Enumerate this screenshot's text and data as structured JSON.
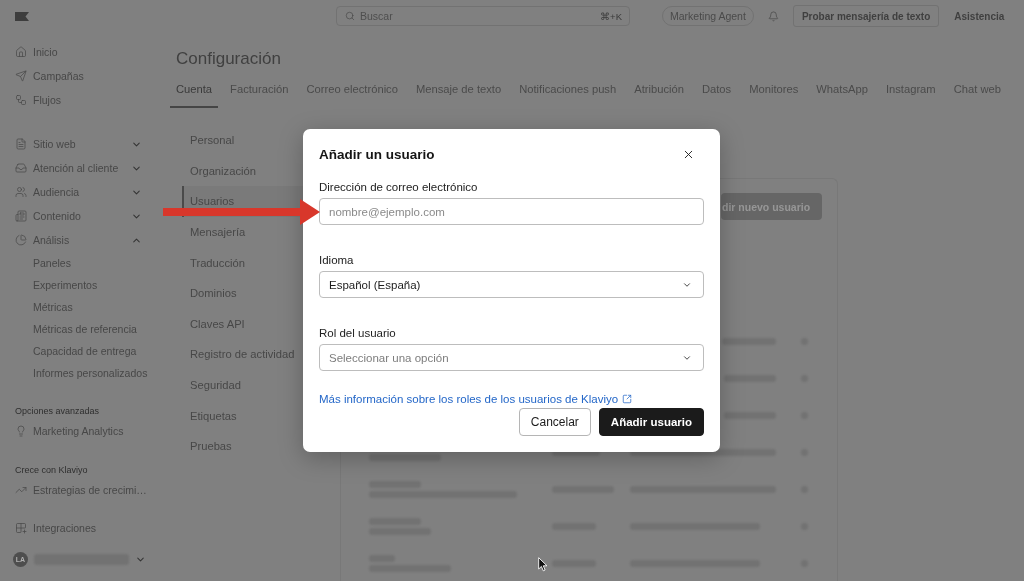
{
  "top_bar": {
    "search": {
      "placeholder": "Buscar",
      "shortcut": "⌘+K"
    },
    "agent_button": "Marketing Agent",
    "sms_button": "Probar mensajería de texto",
    "help_link": "Asistencia"
  },
  "sidebar": {
    "primary": [
      "Inicio",
      "Campañas",
      "Flujos"
    ],
    "groups": [
      {
        "label": "Sitio web",
        "expanded": false
      },
      {
        "label": "Atención al cliente",
        "expanded": false
      },
      {
        "label": "Audiencia",
        "expanded": false
      },
      {
        "label": "Contenido",
        "expanded": false
      },
      {
        "label": "Análisis",
        "expanded": true,
        "children": [
          "Paneles",
          "Experimentos",
          "Métricas",
          "Métricas de referencia",
          "Capacidad de entrega",
          "Informes personalizados"
        ]
      }
    ],
    "sections": [
      {
        "heading": "Opciones avanzadas",
        "items": [
          "Marketing Analytics"
        ]
      },
      {
        "heading": "Crece con Klaviyo",
        "items": [
          "Estrategias de crecimi…"
        ]
      }
    ],
    "integrations": "Integraciones",
    "account": {
      "initials": "LA"
    }
  },
  "main": {
    "title": "Configuración",
    "tabs": [
      {
        "label": "Cuenta",
        "selected": true
      },
      {
        "label": "Facturación",
        "selected": false
      },
      {
        "label": "Correo electrónico",
        "selected": false
      },
      {
        "label": "Mensaje de texto",
        "selected": false
      },
      {
        "label": "Notificaciones push",
        "selected": false
      },
      {
        "label": "Atribución",
        "selected": false
      },
      {
        "label": "Datos",
        "selected": false
      },
      {
        "label": "Monitores",
        "selected": false
      },
      {
        "label": "WhatsApp",
        "selected": false
      },
      {
        "label": "Instagram",
        "selected": false
      },
      {
        "label": "Chat web",
        "selected": false
      }
    ],
    "settings_nav": [
      {
        "label": "Personal",
        "selected": false
      },
      {
        "label": "Organización",
        "selected": false
      },
      {
        "label": "Usuarios",
        "selected": true
      },
      {
        "label": "Mensajería",
        "selected": false
      },
      {
        "label": "Traducción",
        "selected": false
      },
      {
        "label": "Dominios",
        "selected": false
      },
      {
        "label": "Claves API",
        "selected": false
      },
      {
        "label": "Registro de actividad",
        "selected": false
      },
      {
        "label": "Seguridad",
        "selected": false
      },
      {
        "label": "Etiquetas",
        "selected": false
      },
      {
        "label": "Pruebas",
        "selected": false
      }
    ],
    "users_panel": {
      "add_button": "dir nuevo usuario"
    }
  },
  "dialog": {
    "title": "Añadir un usuario",
    "fields": [
      {
        "kind": "text_input",
        "label": "Dirección de correo electrónico",
        "placeholder": "nombre@ejemplo.com"
      },
      {
        "kind": "select",
        "label": "Idioma",
        "value": "Español (España)"
      },
      {
        "kind": "select",
        "label": "Rol del usuario",
        "placeholder": "Seleccionar una opción"
      }
    ],
    "help_link": "Más información sobre los roles de los usuarios de Klaviyo",
    "buttons": [
      {
        "label": "Cancelar",
        "kind": "cancel"
      },
      {
        "label": "Añadir usuario",
        "kind": "submit"
      }
    ]
  }
}
